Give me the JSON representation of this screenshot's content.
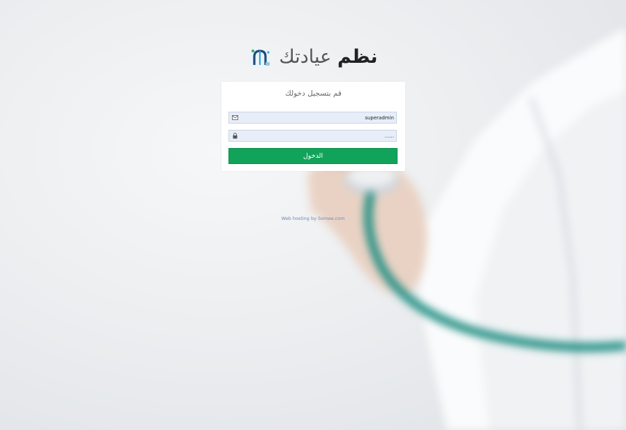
{
  "brand": {
    "name_bold": "نظم",
    "name_light": "عيادتك"
  },
  "login": {
    "title": "قم بتسجيل دخولك",
    "username": {
      "value": "superadmin",
      "icon": "envelope-icon"
    },
    "password": {
      "value": "......",
      "icon": "lock-icon"
    },
    "submit_label": "الدخول"
  },
  "footer": {
    "hosting_text": "Web hosting by Somee.com"
  },
  "colors": {
    "button": "#12a35a",
    "field_bg": "#e8eef9",
    "link": "#6a87b8"
  }
}
